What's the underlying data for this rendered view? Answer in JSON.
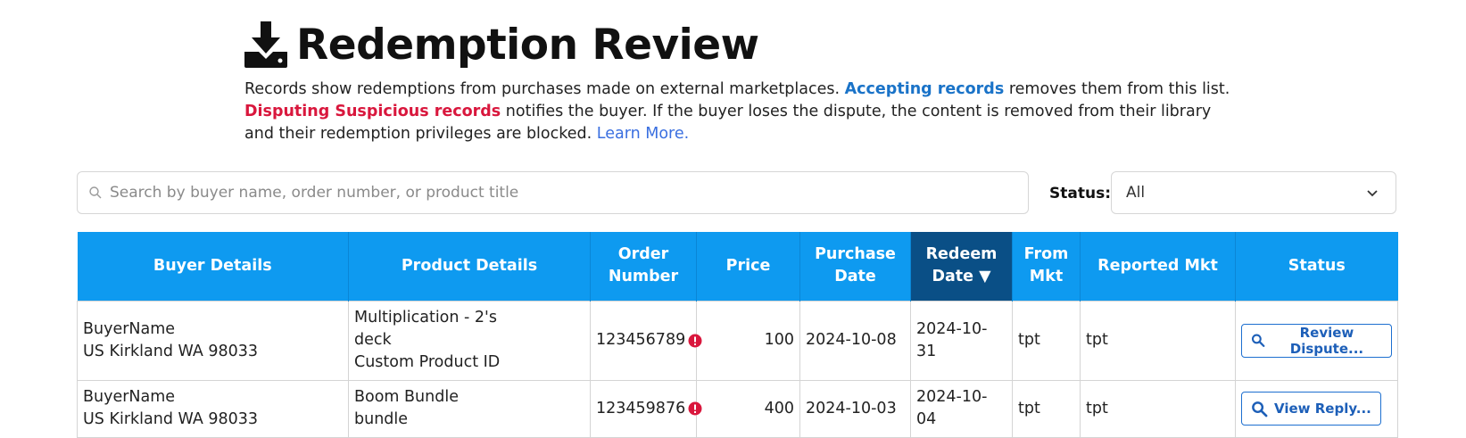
{
  "header": {
    "title": "Redemption Review",
    "icon": "download-icon",
    "description_intro": "Records show redemptions from purchases made on external marketplaces.",
    "accepting_label": "Accepting records",
    "description_mid": "removes them from this list.",
    "disputing_label": "Disputing Suspicious records",
    "description_end": "notifies the buyer. If the buyer loses the dispute, the content is removed from their library and their redemption privileges are blocked.",
    "learn_more": "Learn More."
  },
  "search": {
    "placeholder": "Search by buyer name, order number, or product title",
    "value": ""
  },
  "status_filter": {
    "label": "Status:",
    "selected": "All"
  },
  "table": {
    "columns": [
      "Buyer Details",
      "Product Details",
      "Order Number",
      "Price",
      "Purchase Date",
      "Redeem Date ▼",
      "From Mkt",
      "Reported Mkt",
      "Status"
    ],
    "sorted_column": "Redeem Date",
    "rows": [
      {
        "buyer_name": "BuyerName",
        "buyer_location": "US Kirkland WA 98033",
        "product_line1": "Multiplication - 2's",
        "product_line2": "deck",
        "product_line3": "Custom Product ID",
        "order_number": "123456789",
        "price": "100",
        "purchase_date": "2024-10-08",
        "redeem_date": "2024-10-31",
        "from_mkt": "tpt",
        "reported_mkt": "tpt",
        "action": "Review Dispute..."
      },
      {
        "buyer_name": "BuyerName",
        "buyer_location": "US Kirkland WA 98033",
        "product_line1": "Boom Bundle",
        "product_line2": "bundle",
        "product_line3": "",
        "order_number": "123459876",
        "price": "400",
        "purchase_date": "2024-10-03",
        "redeem_date": "2024-10-04",
        "from_mkt": "tpt",
        "reported_mkt": "tpt",
        "action": "View Reply..."
      }
    ]
  },
  "colors": {
    "header_bg": "#0e9af0",
    "sorted_header_bg": "#0a4f86",
    "accent_blue": "#1a73c8",
    "danger_red": "#d9173d"
  }
}
